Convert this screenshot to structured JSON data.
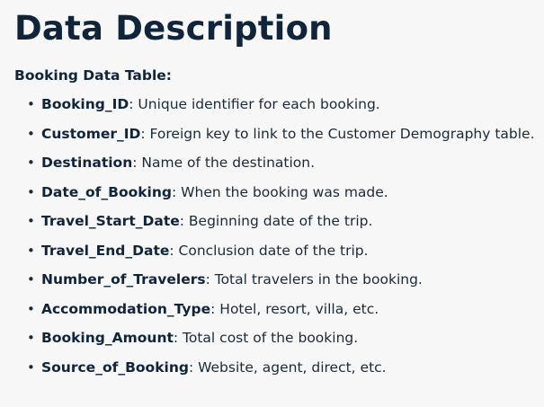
{
  "title": "Data Description",
  "subtitle": "Booking Data Table:",
  "fields": [
    {
      "name": "Booking_ID",
      "desc": ": Unique identifier for each booking."
    },
    {
      "name": "Customer_ID",
      "desc": ": Foreign key to link to the Customer Demography table."
    },
    {
      "name": "Destination",
      "desc": ": Name of the destination."
    },
    {
      "name": "Date_of_Booking",
      "desc": ": When the booking was made."
    },
    {
      "name": "Travel_Start_Date",
      "desc": ": Beginning date of the trip."
    },
    {
      "name": "Travel_End_Date",
      "desc": ": Conclusion date of the trip."
    },
    {
      "name": "Number_of_Travelers",
      "desc": ": Total travelers in the booking."
    },
    {
      "name": "Accommodation_Type",
      "desc": ": Hotel, resort, villa, etc."
    },
    {
      "name": "Booking_Amount",
      "desc": ": Total cost of the booking."
    },
    {
      "name": "Source_of_Booking",
      "desc": ": Website, agent, direct, etc."
    }
  ],
  "colors": {
    "background": "#f7f7f8",
    "heading": "#10243a",
    "text": "#1b2a38"
  }
}
